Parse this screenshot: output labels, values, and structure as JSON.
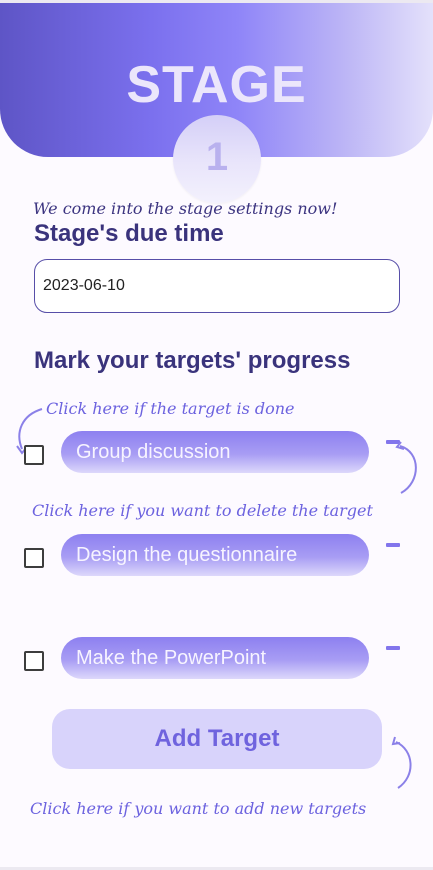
{
  "header": {
    "title": "STAGE",
    "stage_number": "1"
  },
  "hints": {
    "intro": "We come into the stage settings now!",
    "done": "Click here if the target is done",
    "delete": "Click here if you want to delete the target",
    "add": "Click here if you want to add new targets"
  },
  "due_time": {
    "label": "Stage's due time",
    "value": "2023-06-10"
  },
  "progress": {
    "label": "Mark your targets' progress"
  },
  "targets": [
    {
      "name": "Group discussion",
      "done": false
    },
    {
      "name": "Design the questionnaire",
      "done": false
    },
    {
      "name": "Make the PowerPoint",
      "done": false
    }
  ],
  "add_button": {
    "label": "Add Target"
  },
  "colors": {
    "header_start": "#5e55c6",
    "header_mid": "#8f85f8",
    "header_end": "#e4e1fb",
    "title_text": "#3a337c",
    "hint_text": "#6c62df",
    "target_pill": "#a89df4",
    "add_button_bg": "#d8d3fb"
  }
}
